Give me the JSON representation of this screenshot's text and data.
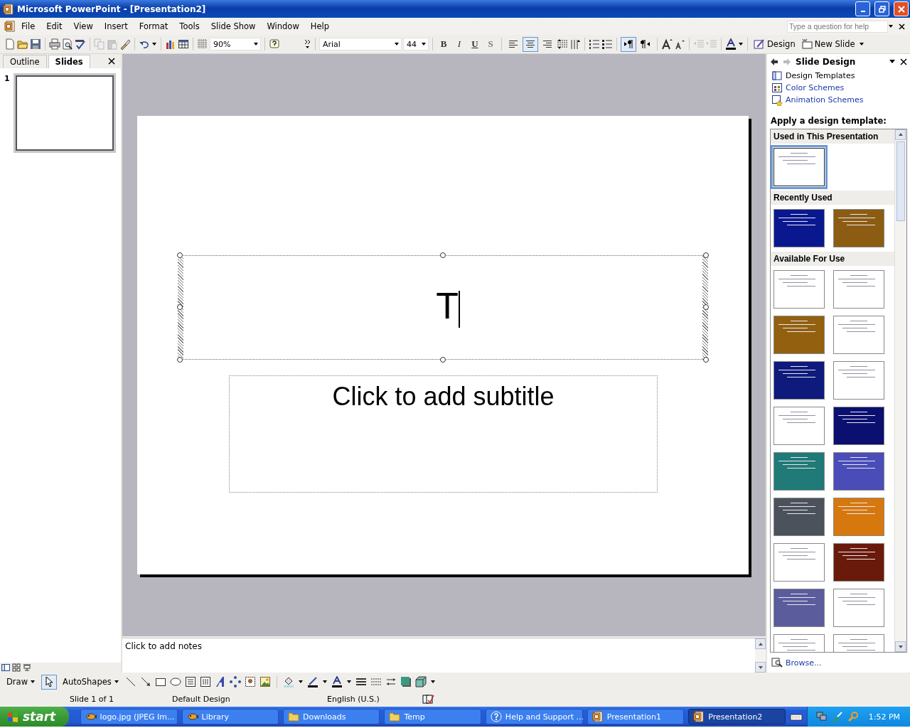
{
  "window": {
    "title": "Microsoft PowerPoint - [Presentation2]"
  },
  "menu": [
    "File",
    "Edit",
    "View",
    "Insert",
    "Format",
    "Tools",
    "Slide Show",
    "Window",
    "Help"
  ],
  "help_search": {
    "placeholder": "Type a question for help"
  },
  "standard_toolbar": {
    "zoom": "90%"
  },
  "formatting_toolbar": {
    "font": "Arial",
    "size": "44",
    "styles": [
      "B",
      "I",
      "U",
      "S"
    ],
    "align": [
      {
        "selected": false
      },
      {
        "selected": true
      },
      {
        "selected": false
      }
    ],
    "direction": [
      {
        "selected": true
      },
      {
        "selected": false
      }
    ],
    "buttons": [
      "Design",
      "New Slide"
    ]
  },
  "left_pane": {
    "tabs": [
      {
        "label": "Outline",
        "selected": false
      },
      {
        "label": "Slides",
        "selected": true
      }
    ],
    "slides": [
      {
        "number": "1",
        "selected": true
      }
    ]
  },
  "slide": {
    "title_text": "T",
    "subtitle_placeholder": "Click to add subtitle"
  },
  "notes": {
    "placeholder": "Click to add notes"
  },
  "task_pane": {
    "title": "Slide Design",
    "links": [
      {
        "label": "Design Templates",
        "selected": true
      },
      {
        "label": "Color Schemes",
        "selected": false
      },
      {
        "label": "Animation Schemes",
        "selected": false
      }
    ],
    "heading": "Apply a design template:",
    "sections": [
      {
        "title": "Used in This Presentation",
        "templates": [
          {
            "color": "#ffffff",
            "selected": true
          }
        ]
      },
      {
        "title": "Recently Used",
        "templates": [
          {
            "color": "#0a1890",
            "selected": false
          },
          {
            "color": "#8c5c12",
            "selected": false
          }
        ]
      },
      {
        "title": "Available For Use",
        "templates": [
          {
            "color": "#ffffff",
            "selected": false
          },
          {
            "color": "#ffffff",
            "selected": false
          },
          {
            "color": "#93600f",
            "selected": false
          },
          {
            "color": "#ffffff",
            "selected": false
          },
          {
            "color": "#0e1a7c",
            "selected": false
          },
          {
            "color": "#ffffff",
            "selected": false
          },
          {
            "color": "#ffffff",
            "selected": false
          },
          {
            "color": "#0b0f70",
            "selected": false
          },
          {
            "color": "#1f7a78",
            "selected": false
          },
          {
            "color": "#4a4cb8",
            "selected": false
          },
          {
            "color": "#4c525c",
            "selected": false
          },
          {
            "color": "#d6780e",
            "selected": false
          },
          {
            "color": "#ffffff",
            "selected": false
          },
          {
            "color": "#6a1a0a",
            "selected": false
          },
          {
            "color": "#5a5c9c",
            "selected": false
          },
          {
            "color": "#ffffff",
            "selected": false
          },
          {
            "color": "#ffffff",
            "selected": false
          },
          {
            "color": "#ffffff",
            "selected": false
          }
        ]
      }
    ],
    "browse": "Browse..."
  },
  "drawing_toolbar": {
    "draw": "Draw",
    "autoshapes": "AutoShapes"
  },
  "status_bar": [
    "Slide 1 of 1",
    "Default Design",
    "English (U.S.)"
  ],
  "taskbar": {
    "start": "start",
    "tasks": [
      {
        "label": "logo.jpg (JPEG Im...",
        "kind": "image",
        "selected": false
      },
      {
        "label": "Library",
        "kind": "image",
        "selected": false
      },
      {
        "label": "Downloads",
        "kind": "folder",
        "selected": false
      },
      {
        "label": "Temp",
        "kind": "folder",
        "selected": false
      },
      {
        "label": "Help and Support ...",
        "kind": "help",
        "selected": false
      },
      {
        "label": "Presentation1",
        "kind": "powerpoint",
        "selected": false
      },
      {
        "label": "Presentation2",
        "kind": "powerpoint",
        "selected": true
      }
    ],
    "clock": "1:52 PM"
  }
}
